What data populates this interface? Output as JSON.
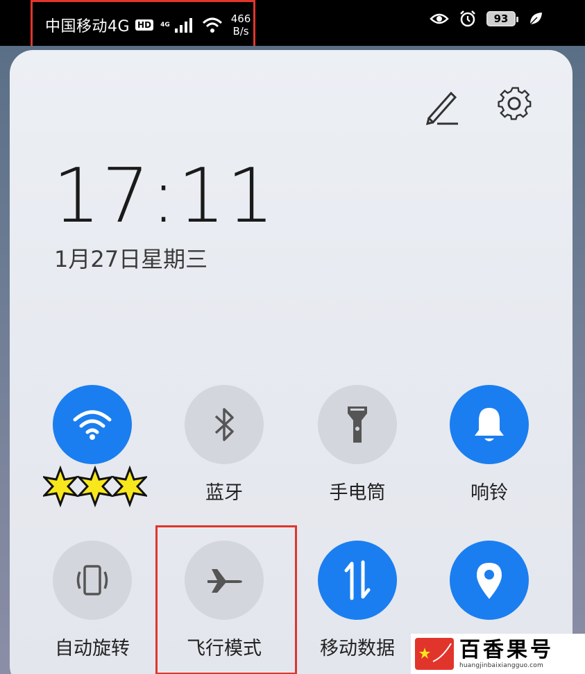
{
  "status_bar": {
    "carrier": "中国移动4G",
    "hd_badge": "HD",
    "network_type": "4G",
    "speed_value": "466",
    "speed_unit": "B/s",
    "battery_level": "93",
    "icons": [
      "signal-icon",
      "wifi-icon",
      "eye-icon",
      "alarm-icon",
      "leaf-icon"
    ]
  },
  "header": {
    "edit_icon": "pencil-icon",
    "settings_icon": "gear-icon"
  },
  "clock": {
    "time": "17:11",
    "date": "1月27日星期三"
  },
  "tiles_row1": [
    {
      "label": "***",
      "icon": "wifi-icon",
      "state": "on"
    },
    {
      "label": "蓝牙",
      "icon": "bluetooth-icon",
      "state": "off"
    },
    {
      "label": "手电筒",
      "icon": "flashlight-icon",
      "state": "off"
    },
    {
      "label": "响铃",
      "icon": "bell-icon",
      "state": "on"
    }
  ],
  "tiles_row2": [
    {
      "label": "自动旋转",
      "icon": "rotate-icon",
      "state": "off"
    },
    {
      "label": "飞行模式",
      "icon": "airplane-icon",
      "state": "off"
    },
    {
      "label": "移动数据",
      "icon": "data-arrows-icon",
      "state": "on"
    },
    {
      "label": "",
      "icon": "location-icon",
      "state": "on"
    }
  ],
  "watermark": {
    "title": "百香果号",
    "url": "huangjinbaixiangguo.com"
  },
  "colors": {
    "accent": "#1a7ef0",
    "tile_off": "#d3d6dc",
    "highlight": "#e1352c"
  }
}
